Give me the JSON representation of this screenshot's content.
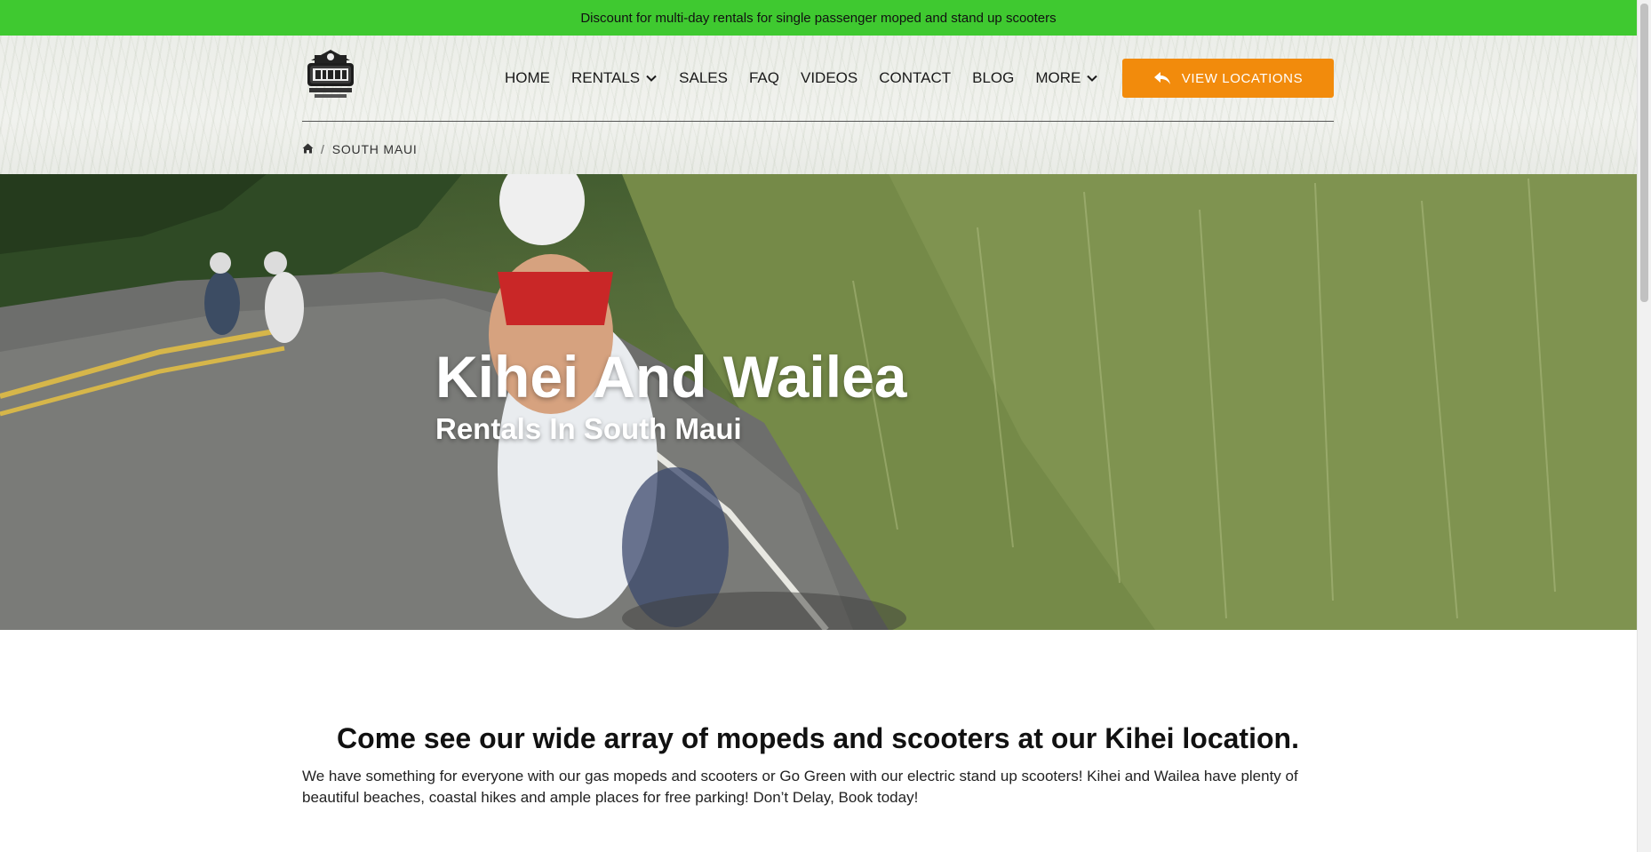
{
  "promo": {
    "text": "Discount for multi-day rentals for single passenger moped and stand up scooters"
  },
  "header": {
    "logo_alt": "808 Rides Maui Hawaii",
    "nav": [
      {
        "label": "HOME",
        "has_dropdown": false
      },
      {
        "label": "RENTALS",
        "has_dropdown": true
      },
      {
        "label": "SALES",
        "has_dropdown": false
      },
      {
        "label": "FAQ",
        "has_dropdown": false
      },
      {
        "label": "VIDEOS",
        "has_dropdown": false
      },
      {
        "label": "CONTACT",
        "has_dropdown": false
      },
      {
        "label": "BLOG",
        "has_dropdown": false
      },
      {
        "label": "MORE",
        "has_dropdown": true
      }
    ],
    "cta_label": "VIEW LOCATIONS",
    "cta_icon": "reply-arrow-icon",
    "cta_color": "#f28b0c"
  },
  "breadcrumb": {
    "home_icon": "home-icon",
    "separator": "/",
    "current": "SOUTH MAUI"
  },
  "hero": {
    "title": "Kihei And Wailea",
    "subtitle": "Rentals In South Maui"
  },
  "content": {
    "heading": "Come see our wide array of mopeds and scooters at our Kihei location.",
    "body": "We have something for everyone with our gas mopeds and scooters or Go Green with our electric stand up scooters! Kihei and Wailea have plenty of beautiful beaches, coastal hikes and ample places for free parking! Don’t Delay, Book today!"
  },
  "colors": {
    "promo_bg": "#3fc930",
    "accent": "#f28b0c"
  }
}
